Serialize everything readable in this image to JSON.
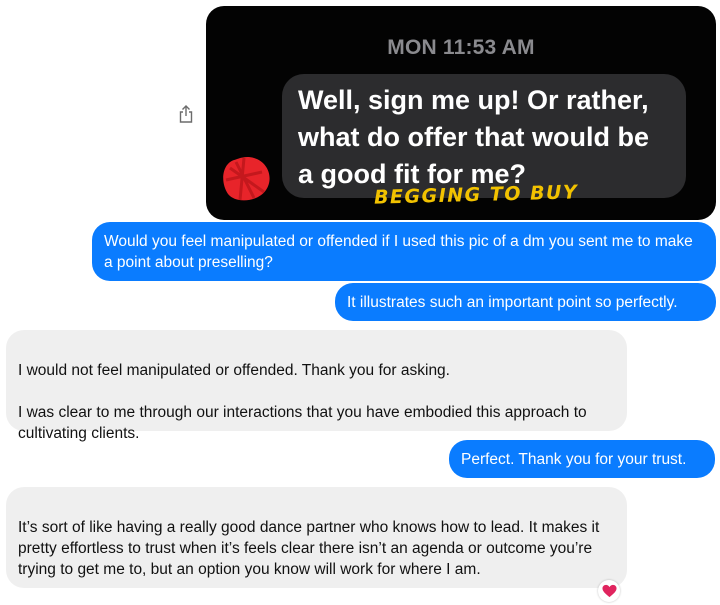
{
  "screenshot": {
    "timestamp": "MON 11:53 AM",
    "message_lines": "Well, sign me up!  Or rather,\nwhat do offer that would be\na good fit for me?",
    "annotation": "BEGGING TO BUY"
  },
  "messages": [
    {
      "direction": "outgoing",
      "text": "Would you feel manipulated or offended if I used this pic of a dm you sent me to make a point about preselling?"
    },
    {
      "direction": "outgoing",
      "text": "It illustrates such an important point so perfectly."
    },
    {
      "direction": "incoming",
      "text": "I would not feel manipulated or offended.  Thank you for asking.\n\nI was clear to me through our interactions that you have embodied this approach to cultivating clients."
    },
    {
      "direction": "outgoing",
      "text": "Perfect. Thank you for your trust."
    },
    {
      "direction": "incoming",
      "text": "It’s sort of like having a really good dance partner who knows how to lead.  It makes it pretty effortless to trust when it’s feels clear there isn’t an agenda or outcome you’re trying to get me to, but an option you know will work for where I am."
    }
  ],
  "reaction": {
    "icon": "heart-icon",
    "color": "#e0245e"
  },
  "colors": {
    "outgoing_bubble": "#0a7cff",
    "incoming_bubble": "#efefef"
  }
}
